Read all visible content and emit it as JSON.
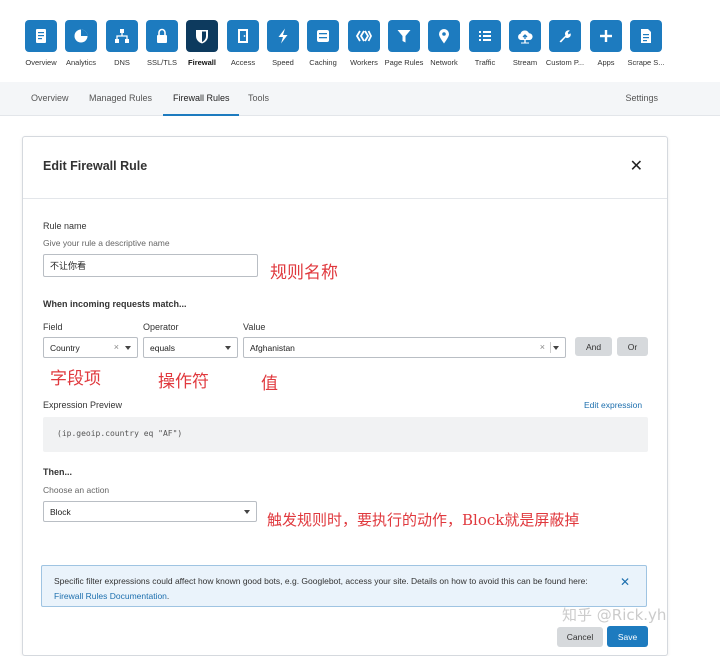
{
  "nav": {
    "items": [
      {
        "key": "overview",
        "label": "Overview",
        "icon": "document-icon",
        "active": false
      },
      {
        "key": "analytics",
        "label": "Analytics",
        "icon": "pie-chart-icon",
        "active": false
      },
      {
        "key": "dns",
        "label": "DNS",
        "icon": "network-tree-icon",
        "active": false
      },
      {
        "key": "ssl",
        "label": "SSL/TLS",
        "icon": "lock-icon",
        "active": false
      },
      {
        "key": "firewall",
        "label": "Firewall",
        "icon": "shield-icon",
        "active": true
      },
      {
        "key": "access",
        "label": "Access",
        "icon": "door-icon",
        "active": false
      },
      {
        "key": "speed",
        "label": "Speed",
        "icon": "lightning-icon",
        "active": false
      },
      {
        "key": "caching",
        "label": "Caching",
        "icon": "server-icon",
        "active": false
      },
      {
        "key": "workers",
        "label": "Workers",
        "icon": "workers-icon",
        "active": false
      },
      {
        "key": "page-rules",
        "label": "Page Rules",
        "icon": "funnel-icon",
        "active": false
      },
      {
        "key": "network",
        "label": "Network",
        "icon": "location-pin-icon",
        "active": false
      },
      {
        "key": "traffic",
        "label": "Traffic",
        "icon": "list-icon",
        "active": false
      },
      {
        "key": "stream",
        "label": "Stream",
        "icon": "cloud-upload-icon",
        "active": false
      },
      {
        "key": "custom-pages",
        "label": "Custom P...",
        "icon": "wrench-icon",
        "active": false
      },
      {
        "key": "apps",
        "label": "Apps",
        "icon": "plus-icon",
        "active": false
      },
      {
        "key": "scrape-shield",
        "label": "Scrape S...",
        "icon": "page-icon",
        "active": false
      }
    ]
  },
  "subnav": {
    "tabs": [
      {
        "label": "Overview"
      },
      {
        "label": "Managed Rules"
      },
      {
        "label": "Firewall Rules"
      },
      {
        "label": "Tools"
      }
    ],
    "settings": "Settings"
  },
  "modal": {
    "title": "Edit Firewall Rule",
    "rule_name_label": "Rule name",
    "rule_name_hint": "Give your rule a descriptive name",
    "rule_name_value": "不让你看",
    "match_heading": "When incoming requests match...",
    "field_label": "Field",
    "operator_label": "Operator",
    "value_label": "Value",
    "field_value": "Country",
    "operator_value": "equals",
    "value_value": "Afghanistan",
    "and_button": "And",
    "or_button": "Or",
    "expression_label": "Expression Preview",
    "edit_expression": "Edit expression",
    "expression": "(ip.geoip.country eq \"AF\")",
    "then_heading": "Then...",
    "action_hint": "Choose an action",
    "action_value": "Block",
    "info_text": "Specific filter expressions could affect how known good bots, e.g. Googlebot, access your site. Details on how to avoid this can be found here: ",
    "info_link": "Firewall Rules Documentation",
    "info_suffix": ".",
    "cancel": "Cancel",
    "save": "Save"
  },
  "annotations": {
    "rule_name": "规则名称",
    "field": "字段项",
    "operator": "操作符",
    "value": "值",
    "action": "触发规则时，要执行的动作，Block就是屏蔽掉"
  },
  "watermark": "知乎 @Rick.yh",
  "colors": {
    "accent": "#1d7bbf",
    "active_tile": "#0d3a5e",
    "annotation": "#e0393e"
  }
}
